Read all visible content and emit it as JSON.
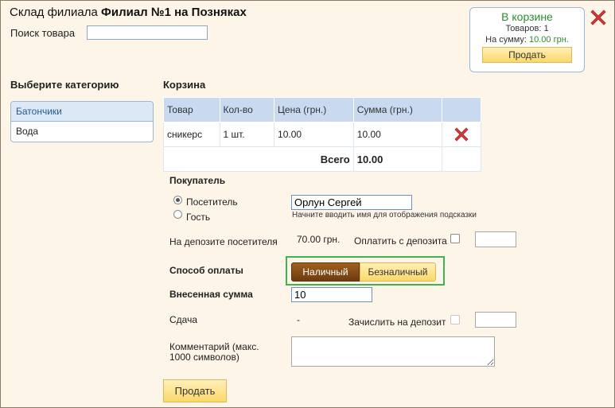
{
  "header": {
    "title_prefix": "Склад филиала",
    "title_branch": "Филиал №1 на Позняках",
    "search_label": "Поиск товара",
    "search_value": ""
  },
  "mini_cart": {
    "title": "В корзине",
    "items_label": "Товаров: 1",
    "sum_label": "На сумму:",
    "sum_value": "10.00 грн.",
    "sell_label": "Продать"
  },
  "categories": {
    "heading": "Выберите категорию",
    "items": [
      {
        "label": "Батончики",
        "active": true
      },
      {
        "label": "Вода",
        "active": false
      }
    ]
  },
  "cart": {
    "heading": "Корзина",
    "columns": [
      "Товар",
      "Кол-во",
      "Цена (грн.)",
      "Сумма (грн.)"
    ],
    "rows": [
      {
        "product": "сникерс",
        "qty": "1 шт.",
        "price": "10.00",
        "sum": "10.00"
      }
    ],
    "total_label": "Всего",
    "total_value": "10.00"
  },
  "buyer": {
    "heading": "Покупатель",
    "option_visitor": "Посетитель",
    "option_guest": "Гость",
    "selected": "visitor",
    "name_value": "Орлун Сергей",
    "name_hint": "Начните вводить имя для отображения подсказки"
  },
  "deposit": {
    "label": "На депозите посетителя",
    "value": "70.00 грн.",
    "pay_from_label": "Оплатить с депозита",
    "pay_from_checked": false,
    "amount_value": ""
  },
  "payment": {
    "label": "Способ оплаты",
    "cash_label": "Наличный",
    "card_label": "Безналичный",
    "selected": "cash"
  },
  "paid": {
    "label": "Внесенная сумма",
    "value": "10"
  },
  "change": {
    "label": "Сдача",
    "value": "-",
    "to_deposit_label": "Зачислить на депозит",
    "to_deposit_checked": false,
    "amount_value": ""
  },
  "comment": {
    "label_line1": "Комментарий (макс.",
    "label_line2": "1000 символов)",
    "value": ""
  },
  "footer": {
    "sell_label": "Продать"
  },
  "colors": {
    "dialog_bg": "#fdf5e8",
    "accent_green": "#2e8b2e",
    "active_payment": "#6b3c10",
    "button_yellow": "#fbd86a",
    "table_header": "#c9daf0",
    "close_red": "#d13a3a"
  },
  "icons": {
    "close": "close-x-icon",
    "delete_row": "delete-x-icon"
  }
}
